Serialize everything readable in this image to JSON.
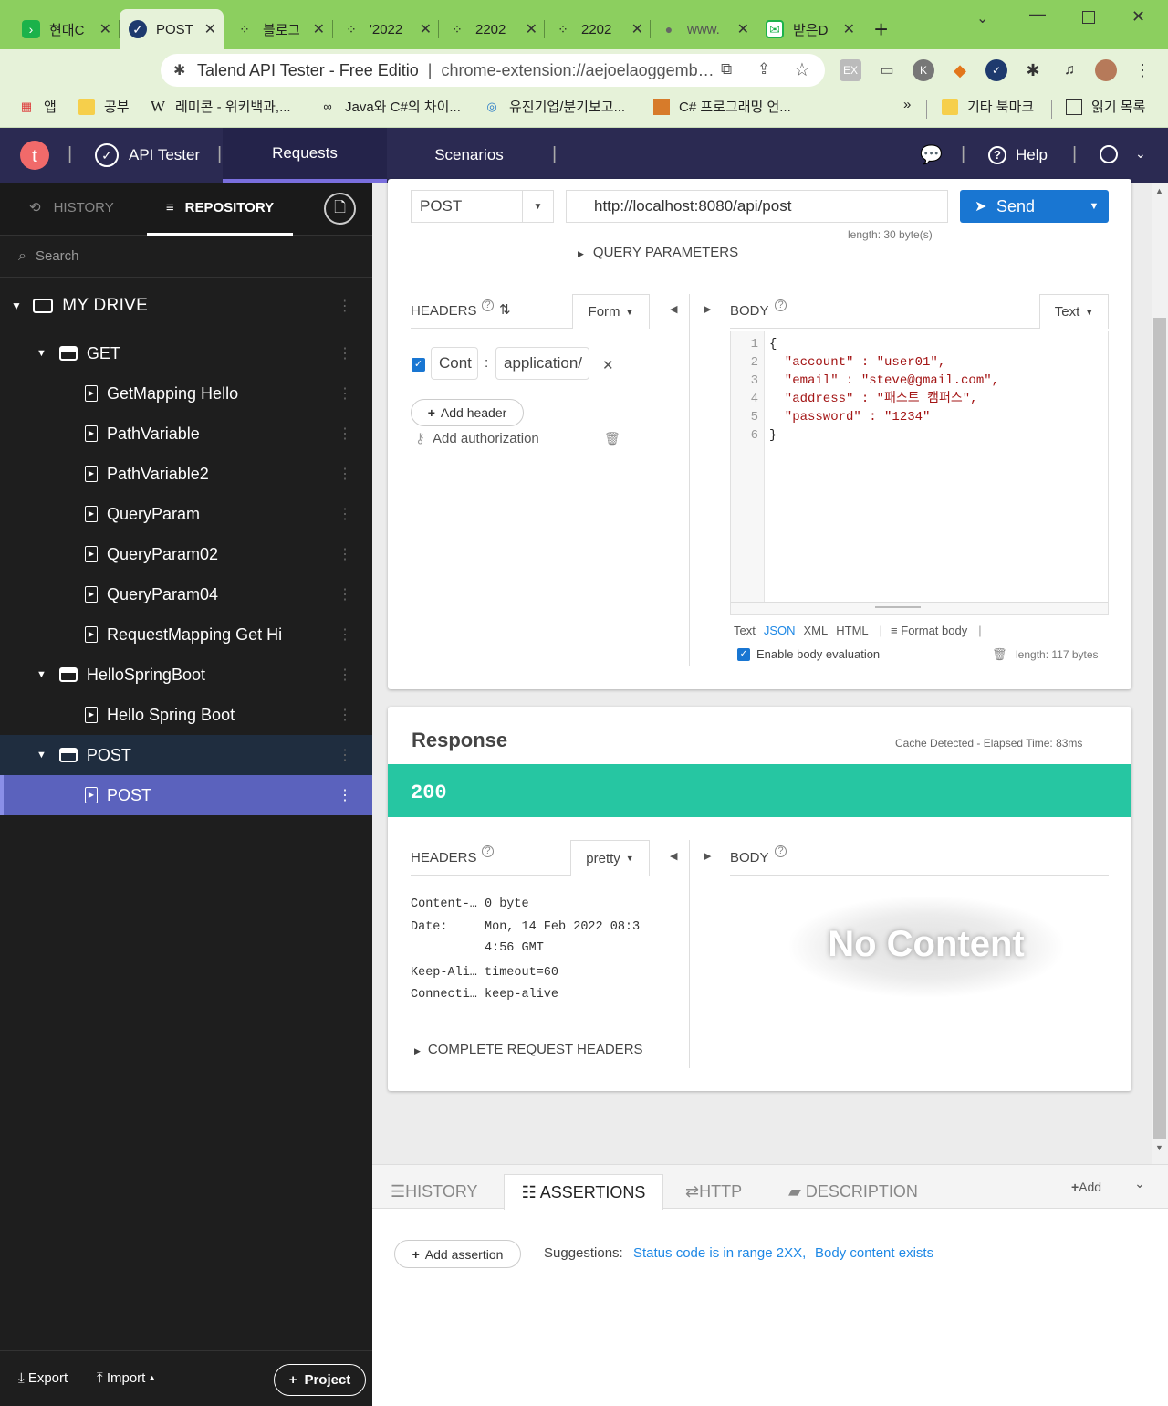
{
  "browser": {
    "tabs": [
      {
        "title": "현대C",
        "icon": "green-arrow-icon"
      },
      {
        "title": "POST",
        "icon": "check-circle-icon"
      },
      {
        "title": "블로그",
        "icon": "dots-icon"
      },
      {
        "title": "'2022",
        "icon": "dots-icon"
      },
      {
        "title": "2202",
        "icon": "dots-icon"
      },
      {
        "title": "2202",
        "icon": "dots-icon"
      },
      {
        "title": "www.",
        "icon": "globe-icon"
      },
      {
        "title": "받은D",
        "icon": "mail-icon"
      }
    ],
    "address_title": "Talend API Tester - Free Editio",
    "address_url": "chrome-extension://aejoelaoggemb…",
    "bookmarks": [
      {
        "label": "앱"
      },
      {
        "label": "공부"
      },
      {
        "label": "레미콘 - 위키백과,..."
      },
      {
        "label": "Java와 C#의 차이..."
      },
      {
        "label": "유진기업/분기보고..."
      },
      {
        "label": "C# 프로그래밍 언..."
      }
    ],
    "more_bookmarks": "»",
    "other_bookmarks": "기타 북마크",
    "reading_list": "읽기 목록",
    "ext_label": "EX"
  },
  "appbar": {
    "logo": "t",
    "product": "API Tester",
    "nav": [
      "Requests",
      "Scenarios"
    ],
    "help": "Help"
  },
  "sidebar": {
    "tabs": {
      "history": "HISTORY",
      "repository": "REPOSITORY"
    },
    "search_placeholder": "Search",
    "drive": "MY DRIVE",
    "tree": [
      {
        "label": "GET",
        "type": "folder"
      },
      {
        "label": "GetMapping Hello",
        "type": "request"
      },
      {
        "label": "PathVariable",
        "type": "request"
      },
      {
        "label": "PathVariable2",
        "type": "request"
      },
      {
        "label": "QueryParam",
        "type": "request"
      },
      {
        "label": "QueryParam02",
        "type": "request"
      },
      {
        "label": "QueryParam04",
        "type": "request"
      },
      {
        "label": "RequestMapping Get Hi",
        "type": "request"
      },
      {
        "label": "HelloSpringBoot",
        "type": "folder"
      },
      {
        "label": "Hello Spring Boot",
        "type": "request"
      },
      {
        "label": "POST",
        "type": "folder"
      },
      {
        "label": "POST",
        "type": "request"
      }
    ],
    "footer": {
      "export": "Export",
      "import": "Import",
      "project": "Project"
    }
  },
  "request": {
    "method": "POST",
    "url": "http://localhost:8080/api/post",
    "url_length": "length: 30 byte(s)",
    "send": "Send",
    "query_params": "QUERY PARAMETERS",
    "headers_label": "HEADERS",
    "headers_mode": "Form",
    "header_key": "Cont",
    "header_value": "application/",
    "header_sep": ":",
    "add_header": "Add header",
    "add_authorization": "Add authorization",
    "body_label": "BODY",
    "body_mode": "Text",
    "body_lines": [
      {
        "n": "1",
        "code": "{"
      },
      {
        "n": "2",
        "code": "  \"account\" : \"user01\","
      },
      {
        "n": "3",
        "code": "  \"email\" : \"steve@gmail.com\","
      },
      {
        "n": "4",
        "code": "  \"address\" : \"패스트 캠퍼스\","
      },
      {
        "n": "5",
        "code": "  \"password\" : \"1234\""
      },
      {
        "n": "6",
        "code": "}"
      }
    ],
    "formats": [
      "Text",
      "JSON",
      "XML",
      "HTML"
    ],
    "format_body": "Format body",
    "enable_eval": "Enable body evaluation",
    "body_length": "length: 117 bytes"
  },
  "response": {
    "title": "Response",
    "meta": "Cache Detected - Elapsed Time: 83ms",
    "status": "200",
    "status_color": "#26c6a2",
    "headers_label": "HEADERS",
    "headers_mode": "pretty",
    "headers": [
      {
        "k": "Content-…",
        "v": "0 byte"
      },
      {
        "k": "Date:",
        "v": "Mon, 14 Feb 2022 08:3"
      },
      {
        "k": "",
        "v": "4:56 GMT"
      },
      {
        "k": "Keep-Ali…",
        "v": "timeout=60"
      },
      {
        "k": "Connecti…",
        "v": "keep-alive"
      }
    ],
    "complete_headers": "COMPLETE REQUEST HEADERS",
    "body_label": "BODY",
    "no_content": "No Content"
  },
  "bottom": {
    "tabs": [
      "HISTORY",
      "ASSERTIONS",
      "HTTP",
      "DESCRIPTION"
    ],
    "add": "Add",
    "add_assertion": "Add assertion",
    "suggestions_label": "Suggestions:",
    "suggestions": [
      "Status code is in range 2XX,",
      "Body content exists"
    ]
  }
}
